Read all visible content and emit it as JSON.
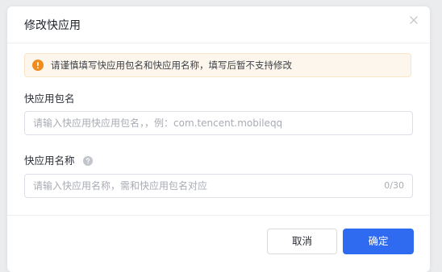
{
  "dialog": {
    "title": "修改快应用",
    "close_icon": "close-icon"
  },
  "alert": {
    "icon": "warning-icon",
    "text": "请谨慎填写快应用包名和快应用名称，填写后暂不支持修改",
    "colors": {
      "icon": "#f08c1c",
      "background": "#fdf6ec"
    }
  },
  "form": {
    "package_name": {
      "label": "快应用包名",
      "value": "",
      "placeholder": "请输入快应用快应用包名，，例：com.tencent.mobileqq"
    },
    "app_name": {
      "label": "快应用名称",
      "help_icon": "question-icon",
      "value": "",
      "placeholder": "请输入快应用名称，需和快应用包名对应",
      "counter": "0/30"
    }
  },
  "footer": {
    "cancel_label": "取消",
    "confirm_label": "确定",
    "colors": {
      "primary": "#2f6bf0"
    }
  }
}
